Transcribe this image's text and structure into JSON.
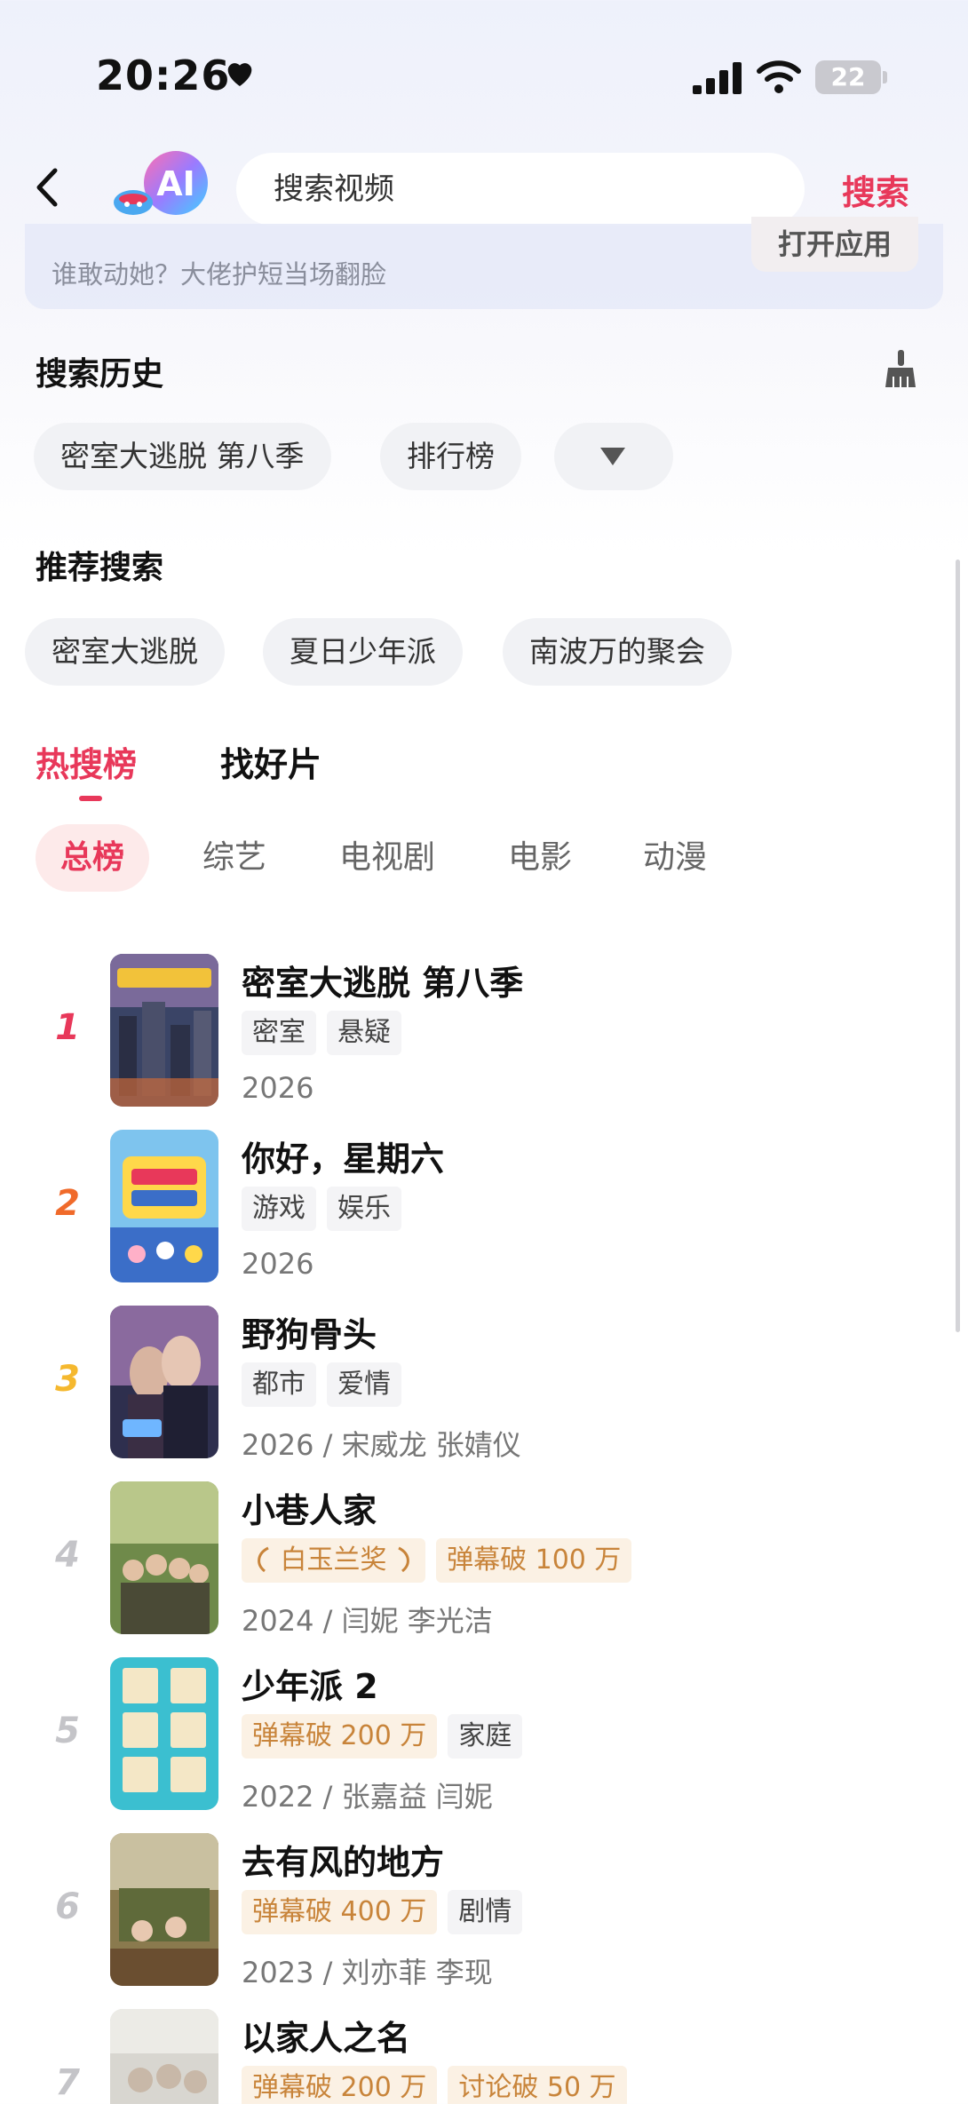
{
  "status_bar": {
    "time": "20:26",
    "battery": "22"
  },
  "header": {
    "search_placeholder": "搜索视频",
    "search_button": "搜索",
    "banner_text": "谁敢动她？大佬护短当场翻脸",
    "open_app": "打开应用"
  },
  "history": {
    "title": "搜索历史",
    "items": [
      "密室大逃脱 第八季",
      "排行榜"
    ]
  },
  "recommend": {
    "title": "推荐搜索",
    "items": [
      "密室大逃脱",
      "夏日少年派",
      "南波万的聚会"
    ]
  },
  "tabs": {
    "main": [
      "热搜榜",
      "找好片"
    ],
    "sub": [
      "总榜",
      "综艺",
      "电视剧",
      "电影",
      "动漫"
    ]
  },
  "ranking": [
    {
      "rank": "1",
      "title": "密室大逃脱 第八季",
      "tags": [
        "密室",
        "悬疑"
      ],
      "meta": "2026"
    },
    {
      "rank": "2",
      "title": "你好，星期六",
      "tags": [
        "游戏",
        "娱乐"
      ],
      "meta": "2026"
    },
    {
      "rank": "3",
      "title": "野狗骨头",
      "tags": [
        "都市",
        "爱情"
      ],
      "meta": "2026 / 宋威龙 张婧仪"
    },
    {
      "rank": "4",
      "title": "小巷人家",
      "tags": [
        "白玉兰奖",
        "弹幕破 100 万"
      ],
      "meta": "2024 / 闫妮 李光洁"
    },
    {
      "rank": "5",
      "title": "少年派 2",
      "tags": [
        "弹幕破 200 万",
        "家庭"
      ],
      "meta": "2022 / 张嘉益 闫妮"
    },
    {
      "rank": "6",
      "title": "去有风的地方",
      "tags": [
        "弹幕破 400 万",
        "剧情"
      ],
      "meta": "2023 / 刘亦菲 李现"
    },
    {
      "rank": "7",
      "title": "以家人之名",
      "tags": [
        "弹幕破 200 万",
        "讨论破 50 万"
      ],
      "meta": ""
    }
  ],
  "colors": {
    "accent": "#e8385a",
    "rank_1": "#e8385a",
    "rank_2": "#f06a2a",
    "rank_3": "#f5b82e",
    "rank_other": "#c4c4c8",
    "gold_tag": "#c8843a"
  },
  "icons": [
    "heart-icon",
    "signal-icon",
    "wifi-icon",
    "back-arrow-icon",
    "ai-logo-icon",
    "broom-icon",
    "dropdown-triangle-icon",
    "laurel-icon"
  ]
}
